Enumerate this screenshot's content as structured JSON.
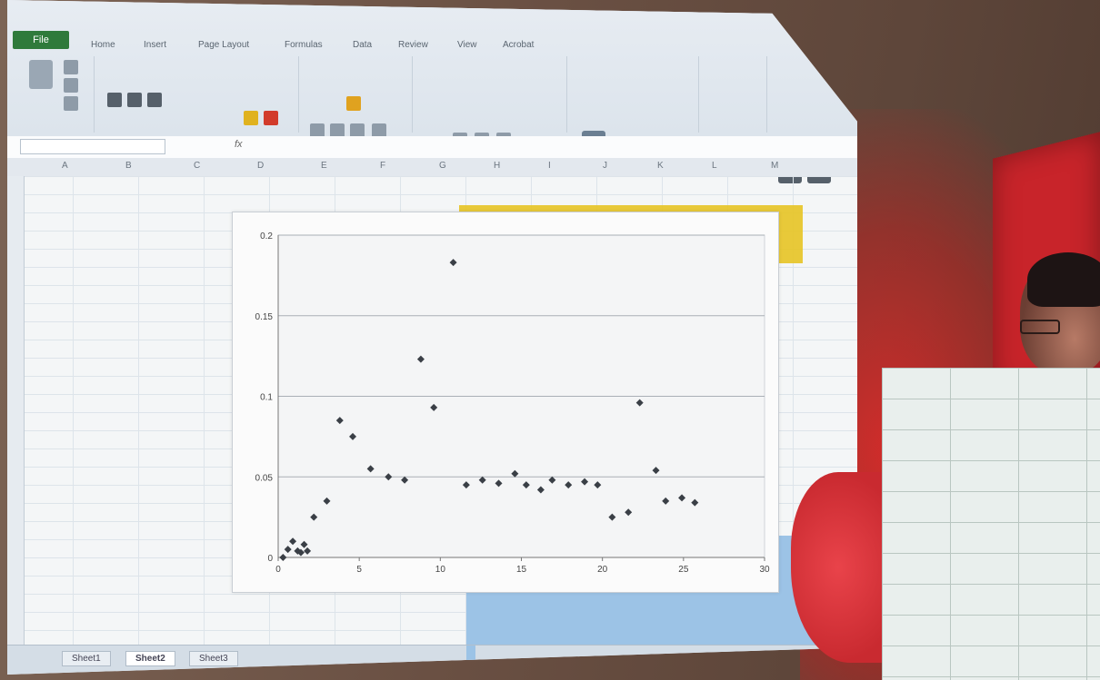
{
  "app": {
    "file_tab": "File",
    "name_box": "",
    "formula_prefix": "fx",
    "tabs": [
      "Home",
      "Insert",
      "Page Layout",
      "Formulas",
      "Data",
      "Review",
      "View",
      "Acrobat"
    ],
    "columns": [
      "A",
      "B",
      "C",
      "D",
      "E",
      "F",
      "G",
      "H",
      "I",
      "J",
      "K",
      "L",
      "M"
    ],
    "sheet_tabs": [
      "Sheet1",
      "Sheet2",
      "Sheet3"
    ],
    "colors": {
      "file_green": "#2f7a3b",
      "highlight_yellow": "#e7c423",
      "selection_blue": "#9cc3e6"
    }
  },
  "chart_data": {
    "type": "scatter",
    "ylim": [
      0,
      0.2
    ],
    "xlim": [
      0,
      30
    ],
    "yticks": [
      "0",
      "0.05",
      "0.1",
      "0.15",
      "0.2"
    ],
    "xticks": [
      "0",
      "5",
      "10",
      "15",
      "20",
      "25",
      "30"
    ],
    "grid": true,
    "series": [
      {
        "x": [
          0.3,
          0.6,
          0.9,
          1.2,
          1.4,
          1.6,
          1.8,
          2.2,
          3.0,
          3.8,
          4.6,
          5.7,
          6.8,
          7.8,
          8.8,
          9.6,
          10.8,
          11.6,
          12.6,
          13.6,
          14.6,
          15.3,
          16.2,
          16.9,
          17.9,
          18.9,
          19.7,
          20.6,
          21.6,
          22.3,
          23.3,
          23.9,
          24.9,
          25.7
        ],
        "y": [
          0,
          0.005,
          0.01,
          0.004,
          0.003,
          0.008,
          0.004,
          0.025,
          0.035,
          0.085,
          0.075,
          0.055,
          0.05,
          0.048,
          0.123,
          0.093,
          0.183,
          0.045,
          0.048,
          0.046,
          0.052,
          0.045,
          0.042,
          0.048,
          0.045,
          0.047,
          0.045,
          0.025,
          0.028,
          0.096,
          0.054,
          0.035,
          0.037,
          0.034
        ]
      }
    ]
  }
}
